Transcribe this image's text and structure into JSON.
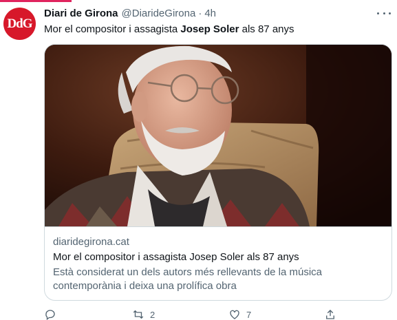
{
  "tweet": {
    "avatar_text": "DdG",
    "author_name": "Diari de Girona",
    "author_handle": "@DiarideGirona",
    "separator": "·",
    "time": "4h",
    "text_before": "Mor el compositor i assagista ",
    "text_bold": "Josep Soler",
    "text_after": " als 87 anys"
  },
  "card": {
    "domain": "diaridegirona.cat",
    "title": "Mor el compositor i assagista Josep Soler als 87 anys",
    "description": "Està considerat un dels autors més rellevants de la música contemporània i deixa una prolífica obra"
  },
  "actions": {
    "reply_count": "",
    "retweet_count": "2",
    "like_count": "7"
  },
  "colors": {
    "brand_red": "#d7182a",
    "accent_pink": "#e0245e",
    "text_primary": "#0f1419",
    "text_secondary": "#536471",
    "border": "#cfd9de"
  },
  "icons": [
    "more-icon",
    "reply-icon",
    "retweet-icon",
    "like-icon",
    "share-icon"
  ]
}
